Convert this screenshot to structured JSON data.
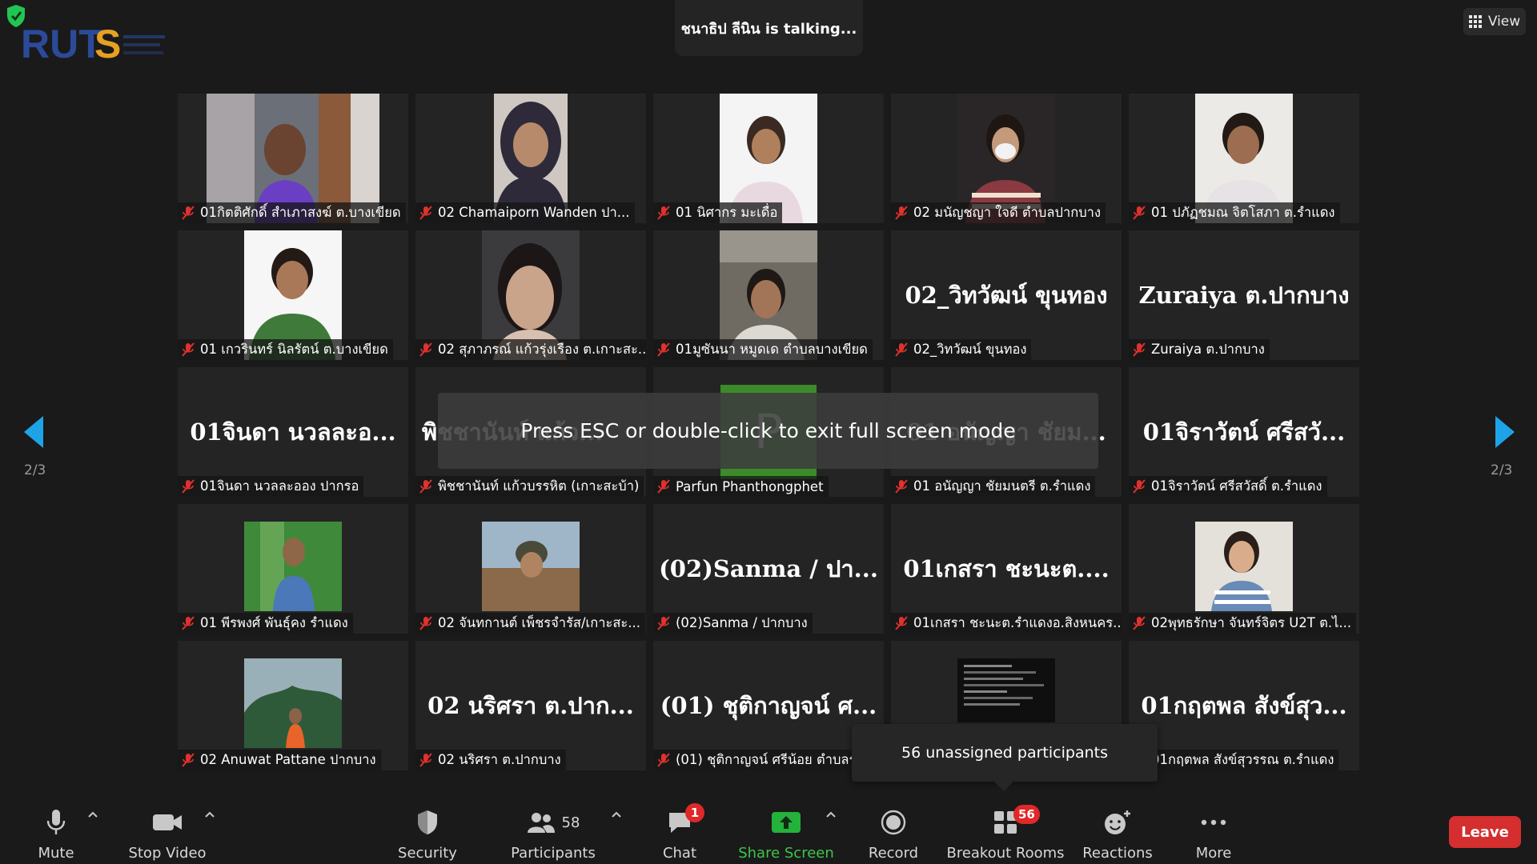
{
  "talking_banner": "ชนาธิป ลีนิน is  talking...",
  "view_button": {
    "label": "View",
    "icon": "grid-icon"
  },
  "page_indicator": "2/3",
  "esc_overlay": "Press ESC or double-click to exit full screen mode",
  "tooltip": "56 unassigned participants",
  "tiles": [
    {
      "label": "01กิตติศักดิ์ สำเภาสงฆ์ ต.บางเขียด",
      "type": "video"
    },
    {
      "label": "02 Chamaiporn Wanden ปา...",
      "type": "video"
    },
    {
      "label": "01 นิศากร มะเดื่อ",
      "type": "video"
    },
    {
      "label": "02 มนัญชญา ใจดี ตำบลปากบาง",
      "type": "video"
    },
    {
      "label": "01 ปภัฏชมณ จิตโสภา ต.รำแดง",
      "type": "video"
    },
    {
      "label": "01 เกวรินทร์ นิลรัตน์ ต.บางเขียด",
      "type": "video"
    },
    {
      "label": "02 สุภาภรณ์ แก้วรุ่งเรือง ต.เกาะสะ...",
      "type": "video"
    },
    {
      "label": "01มูซันนา หมูดเด ตำบลบางเขียด",
      "type": "video"
    },
    {
      "label": "02_วิทวัฒน์ ขุนทอง",
      "type": "name",
      "big": "02_วิทวัฒน์ ขุนทอง"
    },
    {
      "label": "Zuraiya ต.ปากบาง",
      "type": "name",
      "big": "Zuraiya ต.ปากบาง"
    },
    {
      "label": "01จินดา นวลละออง ปากรอ",
      "type": "name",
      "big": "01จินดา นวลละอ..."
    },
    {
      "label": "พิชชานันท์ แก้วบรรหิต (เกาะสะบ้า)",
      "type": "name",
      "big": "พิชชานันท์ แก้ว..."
    },
    {
      "label": "Parfun Phanthongphet",
      "type": "avatar",
      "big": "P"
    },
    {
      "label": "01 อนัญญา ชัยมนตรี ต.รำแดง",
      "type": "name",
      "big": "01 อนัญญา ชัยม..."
    },
    {
      "label": "01จิราวัตน์ ศรีสวัสดิ์ ต.รำแดง",
      "type": "name",
      "big": "01จิราวัตน์ ศรีสวั..."
    },
    {
      "label": "01 พีรพงศ์ พันธุ์คง รำแดง",
      "type": "video"
    },
    {
      "label": "02 จันทกานต์ เพ็ชรจำรัส/เกาะสะ...",
      "type": "video"
    },
    {
      "label": "(02)Sanma / ปากบาง",
      "type": "name",
      "big": "(02)Sanma  / ปา..."
    },
    {
      "label": "01เกสรา ชะนะต.รำแดงอ.สิงหนคร...",
      "type": "name",
      "big": "01เกสรา ชะนะต...."
    },
    {
      "label": "02พุทธรักษา จันทร์จิตร U2T  ต.ไ...",
      "type": "video"
    },
    {
      "label": "02 Anuwat Pattane ปากบาง",
      "type": "video"
    },
    {
      "label": "02 นริศรา ต.ปากบาง",
      "type": "name",
      "big": "02 นริศรา ต.ปาก..."
    },
    {
      "label": "(01) ชุติกาญจน์ ศรีน้อย ตำบลรำแดง",
      "type": "name",
      "big": "(01) ชุติกาญจน์ ศ..."
    },
    {
      "label": "",
      "type": "video"
    },
    {
      "label": "01กฤตพล สังข์สุวรรณ ต.รำแดง",
      "type": "name",
      "big": "01กฤตพล สังข์สุว..."
    }
  ],
  "toolbar": {
    "mute": "Mute",
    "stop_video": "Stop Video",
    "security": "Security",
    "participants": "Participants",
    "participants_count": "58",
    "chat": "Chat",
    "chat_badge": "1",
    "share_screen": "Share Screen",
    "record": "Record",
    "breakout_rooms": "Breakout Rooms",
    "breakout_badge": "56",
    "reactions": "Reactions",
    "more": "More",
    "leave": "Leave"
  },
  "colors": {
    "background": "#1a1a1a",
    "tile": "#242424",
    "share_green": "#3ec44c",
    "leave_red": "#d42e2e",
    "mic_off_red": "#e0312f",
    "arrow_blue": "#1fa3e8"
  }
}
